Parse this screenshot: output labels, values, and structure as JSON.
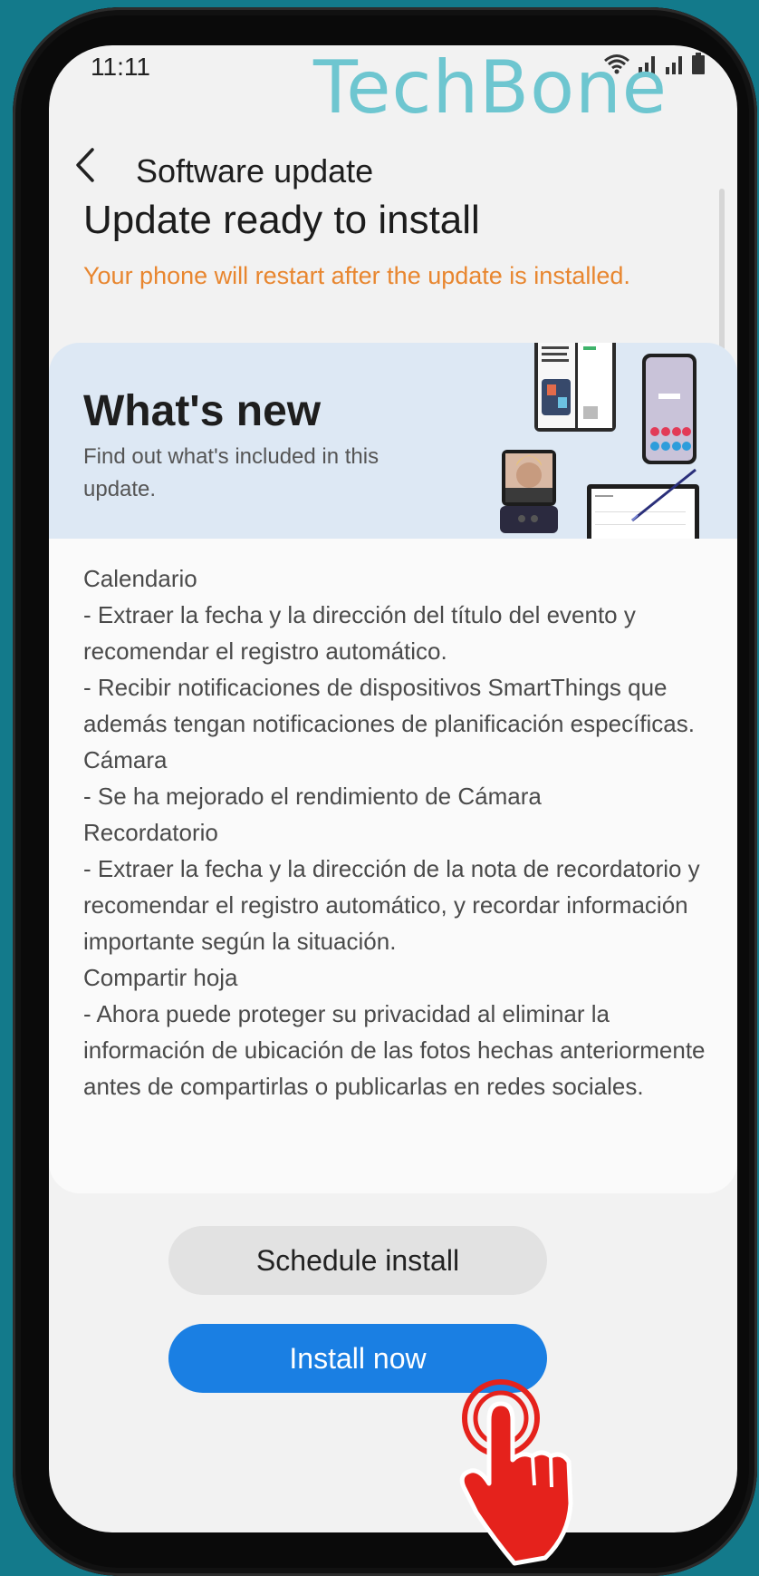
{
  "status_bar": {
    "time": "11:11"
  },
  "watermark": "TechBone",
  "header": {
    "title": "Software update"
  },
  "update": {
    "title": "Update ready to install",
    "restart_notice": "Your phone will restart after the update is installed."
  },
  "whats_new": {
    "title": "What's new",
    "description": "Find out what's included in this update."
  },
  "release_notes": {
    "lines": [
      "Calendario",
      " - Extraer la fecha y la dirección del título del evento y recomendar el registro automático.",
      " - Recibir notificaciones de dispositivos SmartThings que además tengan notificaciones de planificación específicas.",
      "Cámara",
      " - Se ha mejorado el rendimiento de Cámara",
      "Recordatorio",
      " - Extraer la fecha y la dirección de la nota de recordatorio y recomendar el registro automático, y recordar información importante según la situación.",
      "Compartir hoja",
      " - Ahora puede proteger su privacidad al eliminar la información de ubicación de las fotos hechas anteriormente antes de compartirlas o publicarlas en redes sociales."
    ]
  },
  "buttons": {
    "schedule": "Schedule install",
    "install": "Install now"
  },
  "colors": {
    "background": "#137a8b",
    "accent_orange": "#e8862f",
    "install_blue": "#1a7fe3",
    "banner_blue": "#dde8f4",
    "watermark": "#6ec6d0",
    "pointer_red": "#e5221c"
  },
  "icons": {
    "back": "chevron-left-icon",
    "wifi": "wifi-icon",
    "signal": "signal-icon",
    "battery": "battery-icon",
    "pointer": "hand-pointer-icon"
  }
}
